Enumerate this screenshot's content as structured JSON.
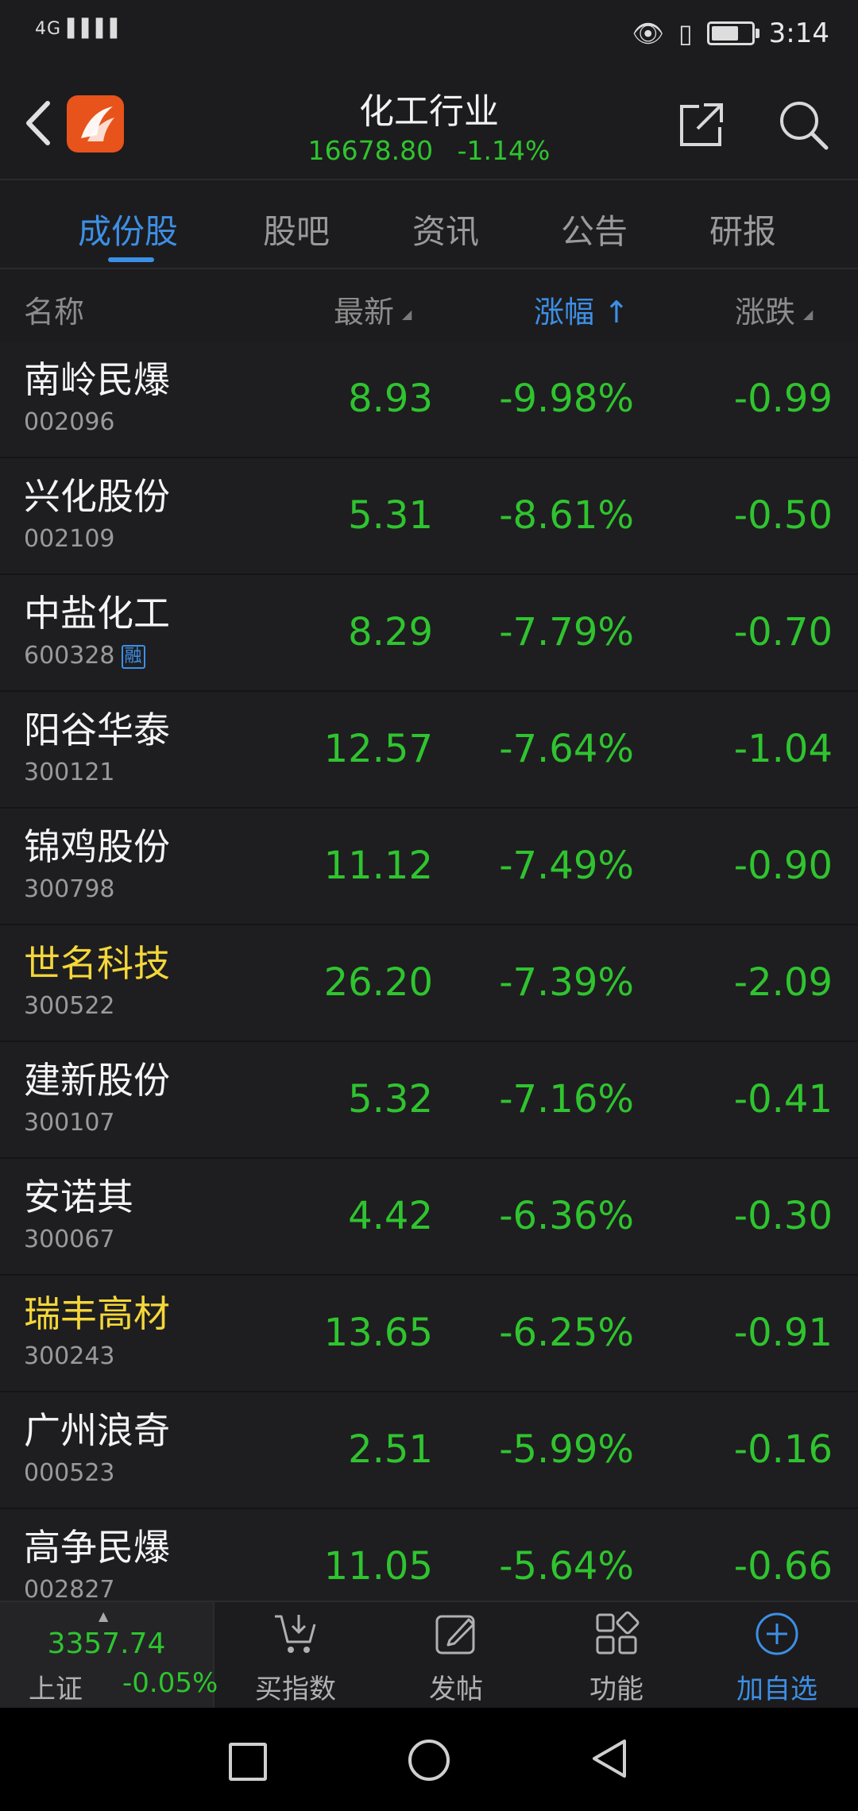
{
  "status_bar": {
    "signal": "4G ▌▌▌▌",
    "time": "3:14"
  },
  "header": {
    "title": "化工行业",
    "index_value": "16678.80",
    "index_change": "-1.14%"
  },
  "tabs": [
    "成份股",
    "股吧",
    "资讯",
    "公告",
    "研报"
  ],
  "active_tab": 0,
  "columns": {
    "name": "名称",
    "latest": "最新",
    "change_pct": "涨幅",
    "change": "涨跌"
  },
  "rows": [
    {
      "name": "南岭民爆",
      "code": "002096",
      "price": "8.93",
      "pct": "-9.98%",
      "chg": "-0.99",
      "highlight": false
    },
    {
      "name": "兴化股份",
      "code": "002109",
      "price": "5.31",
      "pct": "-8.61%",
      "chg": "-0.50",
      "highlight": false
    },
    {
      "name": "中盐化工",
      "code": "600328",
      "badge": "融",
      "price": "8.29",
      "pct": "-7.79%",
      "chg": "-0.70",
      "highlight": false
    },
    {
      "name": "阳谷华泰",
      "code": "300121",
      "price": "12.57",
      "pct": "-7.64%",
      "chg": "-1.04",
      "highlight": false
    },
    {
      "name": "锦鸡股份",
      "code": "300798",
      "price": "11.12",
      "pct": "-7.49%",
      "chg": "-0.90",
      "highlight": false
    },
    {
      "name": "世名科技",
      "code": "300522",
      "price": "26.20",
      "pct": "-7.39%",
      "chg": "-2.09",
      "highlight": true
    },
    {
      "name": "建新股份",
      "code": "300107",
      "price": "5.32",
      "pct": "-7.16%",
      "chg": "-0.41",
      "highlight": false
    },
    {
      "name": "安诺其",
      "code": "300067",
      "price": "4.42",
      "pct": "-6.36%",
      "chg": "-0.30",
      "highlight": false
    },
    {
      "name": "瑞丰高材",
      "code": "300243",
      "price": "13.65",
      "pct": "-6.25%",
      "chg": "-0.91",
      "highlight": true
    },
    {
      "name": "广州浪奇",
      "code": "000523",
      "price": "2.51",
      "pct": "-5.99%",
      "chg": "-0.16",
      "highlight": false
    },
    {
      "name": "高争民爆",
      "code": "002827",
      "price": "11.05",
      "pct": "-5.64%",
      "chg": "-0.66",
      "highlight": false
    }
  ],
  "toolbar": {
    "index_value": "3357.74",
    "index_name": "上证",
    "index_pct": "-0.05%",
    "buy_index": "买指数",
    "post": "发帖",
    "functions": "功能",
    "add_watchlist": "加自选"
  },
  "colors": {
    "down_green": "#2fc42f",
    "accent_blue": "#3d8fe6",
    "highlight_yellow": "#f4d73a",
    "brand_orange": "#e8531b"
  }
}
